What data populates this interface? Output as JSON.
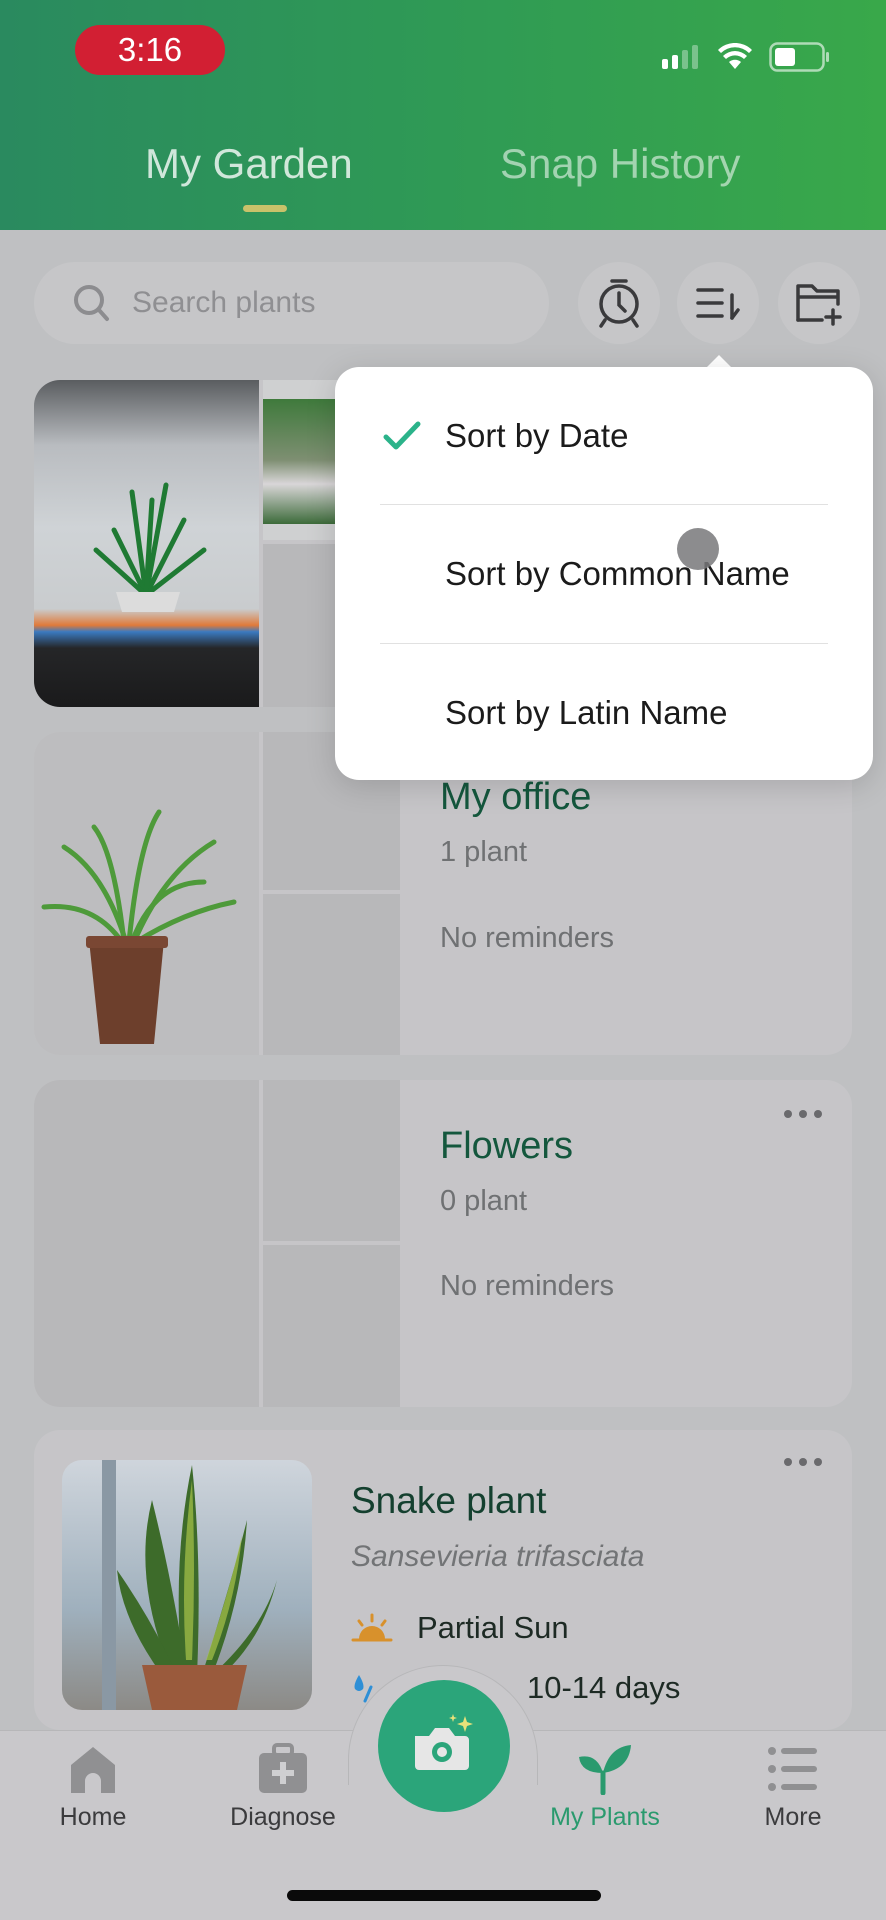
{
  "status_bar": {
    "time": "3:16"
  },
  "header": {
    "tabs": [
      {
        "label": "My Garden",
        "active": true
      },
      {
        "label": "Snap History",
        "active": false
      }
    ]
  },
  "toolbar": {
    "search_placeholder": "Search plants",
    "reminder_button": "alarm-clock-icon",
    "sort_button": "sort-icon",
    "add_folder_button": "folder-add-icon"
  },
  "sort_menu": {
    "items": [
      {
        "label": "Sort by Date",
        "selected": true
      },
      {
        "label": "Sort by Common Name",
        "selected": false
      },
      {
        "label": "Sort by Latin Name",
        "selected": false
      }
    ],
    "check_color": "#2bb38a"
  },
  "collections": [
    {
      "title": "",
      "count": "",
      "reminders": ""
    },
    {
      "title": "My office",
      "count": "1 plant",
      "reminders": "No reminders"
    },
    {
      "title": "Flowers",
      "count": "0 plant",
      "reminders": "No reminders"
    }
  ],
  "plant": {
    "common_name": "Snake plant",
    "latin_name": "Sansevieria trifasciata",
    "light": "Partial Sun",
    "watering": "10-14 days"
  },
  "bottom_nav": {
    "items": [
      {
        "label": "Home",
        "icon": "home-icon",
        "active": false
      },
      {
        "label": "Diagnose",
        "icon": "medkit-icon",
        "active": false
      },
      {
        "label": "My Plants",
        "icon": "sprout-icon",
        "active": true
      },
      {
        "label": "More",
        "icon": "list-icon",
        "active": false
      }
    ],
    "camera_icon": "camera-icon"
  },
  "colors": {
    "brand_green": "#2ba57a",
    "header_gradient_start": "#2a8a5f",
    "header_gradient_end": "#39a84a",
    "title_green": "#14573d",
    "time_pill": "#d21f33"
  }
}
